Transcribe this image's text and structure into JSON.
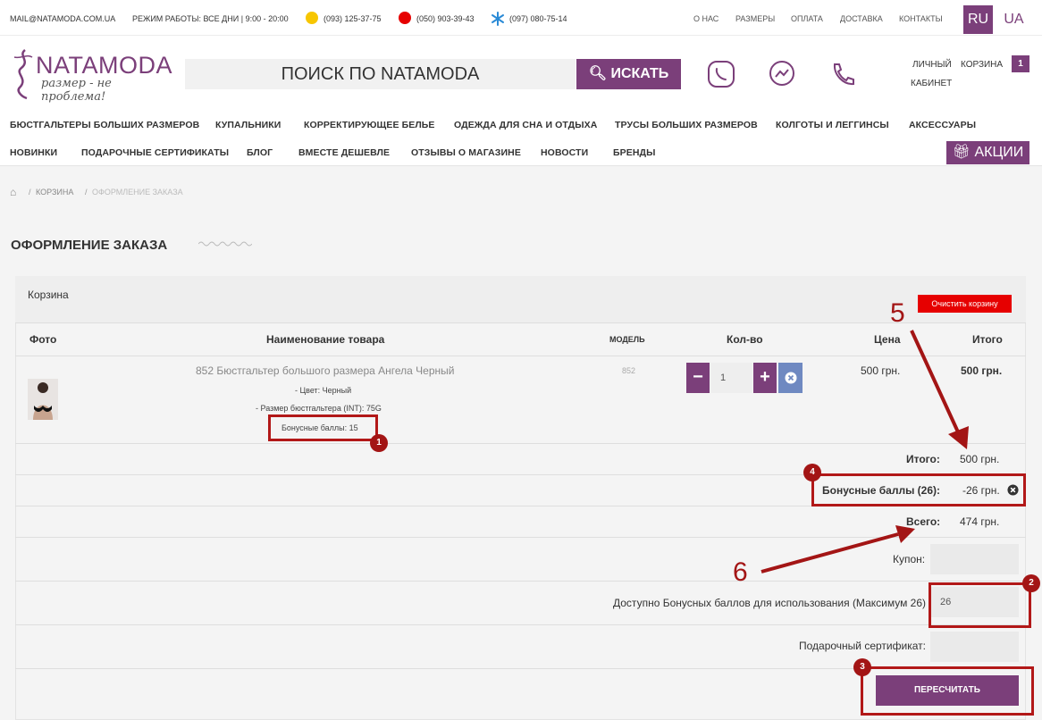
{
  "topbar": {
    "email": "MAIL@NATAMODA.COM.UA",
    "hours": "РЕЖИМ РАБОТЫ: ВСЕ ДНИ | 9:00 - 20:00",
    "phone1": "(093) 125-37-75",
    "phone2": "(050) 903-39-43",
    "phone3": "(097) 080-75-14",
    "nav": [
      "О НАС",
      "РАЗМЕРЫ",
      "ОПЛАТА",
      "ДОСТАВКА",
      "КОНТАКТЫ"
    ],
    "lang_ru": "RU",
    "lang_ua": "UA"
  },
  "header": {
    "brand": "NATAMODA",
    "slogan": "размер - не проблема!",
    "search_placeholder": "ПОИСК ПО NATAMODA",
    "search_button": "ИСКАТЬ",
    "account_line1": "ЛИЧНЫЙ",
    "account_line2": "КАБИНЕТ",
    "cart_label": "КОРЗИНА",
    "cart_count": "1"
  },
  "menu": {
    "row1": [
      "БЮСТГАЛЬТЕРЫ БОЛЬШИХ РАЗМЕРОВ",
      "КУПАЛЬНИКИ",
      "КОРРЕКТИРУЮЩЕЕ БЕЛЬЕ",
      "ОДЕЖДА ДЛЯ СНА И ОТДЫХА",
      "ТРУСЫ БОЛЬШИХ РАЗМЕРОВ",
      "КОЛГОТЫ И ЛЕГГИНСЫ",
      "АКСЕССУАРЫ"
    ],
    "row2": [
      "НОВИНКИ",
      "ПОДАРОЧНЫЕ СЕРТИФИКАТЫ",
      "БЛОГ",
      "ВМЕСТЕ ДЕШЕВЛЕ",
      "ОТЗЫВЫ О МАГАЗИНЕ",
      "НОВОСТИ",
      "БРЕНДЫ"
    ],
    "promo": "АКЦИИ"
  },
  "breadcrumb": {
    "sep": "/",
    "cart": "КОРЗИНА",
    "current": "ОФОРМЛЕНИЕ ЗАКАЗА"
  },
  "page": {
    "title": "ОФОРМЛЕНИЕ ЗАКАЗА"
  },
  "cart": {
    "title": "Корзина",
    "clear_button": "Очистить корзину",
    "columns": {
      "photo": "Фото",
      "name": "Наименование товара",
      "model": "МОДЕЛЬ",
      "qty": "Кол-во",
      "price": "Цена",
      "total": "Итого"
    },
    "item": {
      "name": "852 Бюстгальтер большого размера Ангела Черный",
      "color": "- Цвет: Черный",
      "size": "- Размер бюстгальтера (INT): 75G",
      "bonus": "Бонусные баллы: 15",
      "model": "852",
      "qty": "1",
      "price": "500 грн.",
      "total": "500 грн."
    },
    "summary": {
      "subtotal_label": "Итого:",
      "subtotal_value": "500 грн.",
      "bonus_label": "Бонусные баллы (26):",
      "bonus_value": "-26 грн.",
      "grand_label": "Всего:",
      "grand_value": "474 грн."
    },
    "form": {
      "coupon_label": "Купон:",
      "coupon_value": "",
      "bonus_label": "Доступно Бонусных баллов для использования (Максимум 26)",
      "bonus_value": "26",
      "cert_label": "Подарочный сертификат:",
      "cert_value": "",
      "recalc_button": "ПЕРЕСЧИТАТЬ"
    }
  },
  "annotations": {
    "badge1": "1",
    "badge2": "2",
    "badge3": "3",
    "badge4": "4",
    "num5": "5",
    "num6": "6",
    "color": "#a31515"
  },
  "colors": {
    "brand": "#7b3f7a",
    "danger": "#e60000",
    "remove": "#6f89c1"
  }
}
